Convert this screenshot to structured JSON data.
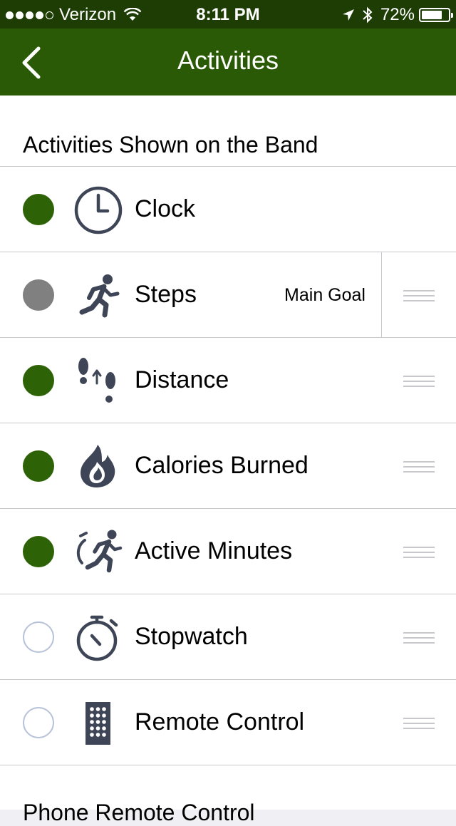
{
  "status_bar": {
    "carrier": "Verizon",
    "time": "8:11 PM",
    "battery": "72%",
    "signal_bars": 4,
    "battery_level": 0.72
  },
  "nav": {
    "title": "Activities"
  },
  "section": {
    "title": "Activities Shown on the Band"
  },
  "activities": [
    {
      "label": "Clock",
      "state": "on",
      "icon": "clock-icon"
    },
    {
      "label": "Steps",
      "state": "gray",
      "icon": "running-icon",
      "badge": "Main Goal"
    },
    {
      "label": "Distance",
      "state": "on",
      "icon": "footsteps-icon"
    },
    {
      "label": "Calories Burned",
      "state": "on",
      "icon": "flame-icon"
    },
    {
      "label": "Active Minutes",
      "state": "on",
      "icon": "active-minutes-icon"
    },
    {
      "label": "Stopwatch",
      "state": "off",
      "icon": "stopwatch-icon"
    },
    {
      "label": "Remote Control",
      "state": "off",
      "icon": "remote-icon"
    }
  ],
  "footer": {
    "text": "Phone Remote Control"
  },
  "colors": {
    "nav_green": "#2a5a06",
    "status_green": "#1d3d05",
    "toggle_on": "#2d6306",
    "icon_gray": "#3e4556"
  }
}
